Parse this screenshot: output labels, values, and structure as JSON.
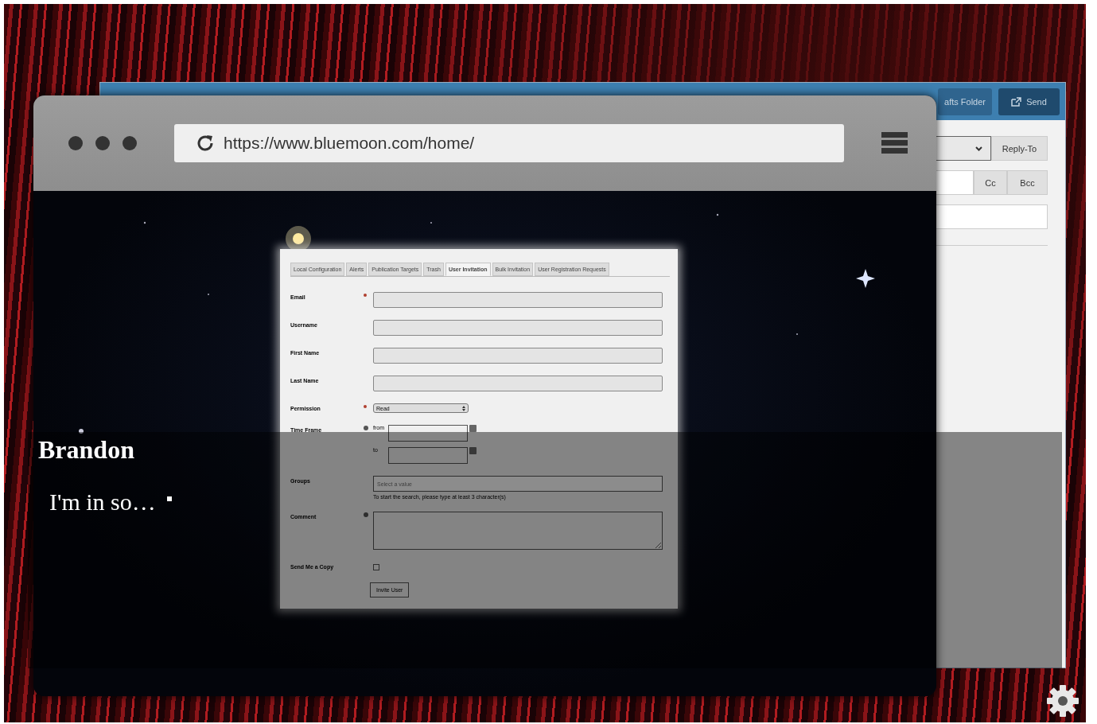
{
  "email_window": {
    "toolbar_buttons": [
      {
        "kind": "folder",
        "label": "afts Folder"
      },
      {
        "kind": "send",
        "label": "Send"
      }
    ],
    "reply_to": "Reply-To",
    "cc": "Cc",
    "bcc": "Bcc"
  },
  "browser": {
    "url": "https://www.bluemoon.com/home/"
  },
  "admin_form": {
    "tabs": [
      {
        "label": "Local Configuration",
        "selected": false
      },
      {
        "label": "Alerts",
        "selected": false
      },
      {
        "label": "Publication Targets",
        "selected": false
      },
      {
        "label": "Trash",
        "selected": false
      },
      {
        "label": "User Invitation",
        "selected": true
      },
      {
        "label": "Bulk Invitation",
        "selected": false
      },
      {
        "label": "User Registration Requests",
        "selected": false
      }
    ],
    "fields": [
      {
        "kind": "text",
        "label": "Email",
        "required": true
      },
      {
        "kind": "text",
        "label": "Username",
        "required": false
      },
      {
        "kind": "text",
        "label": "First Name",
        "required": false
      },
      {
        "kind": "text",
        "label": "Last Name",
        "required": false
      },
      {
        "kind": "select",
        "label": "Permission",
        "required": true,
        "value": "Read"
      },
      {
        "kind": "daterange",
        "label": "Time Frame",
        "help": true,
        "from_label": "from",
        "to_label": "to"
      },
      {
        "kind": "autocomplete",
        "label": "Groups",
        "placeholder": "Select a value",
        "hint": "To start the search, please type at least 3 character(s)"
      },
      {
        "kind": "textarea",
        "label": "Comment",
        "help": true
      },
      {
        "kind": "checkbox",
        "label": "Send Me a Copy",
        "checked": false
      }
    ],
    "submit": "Invite User"
  },
  "dialogue": {
    "speaker": "Brandon",
    "line": "I'm in so…"
  }
}
